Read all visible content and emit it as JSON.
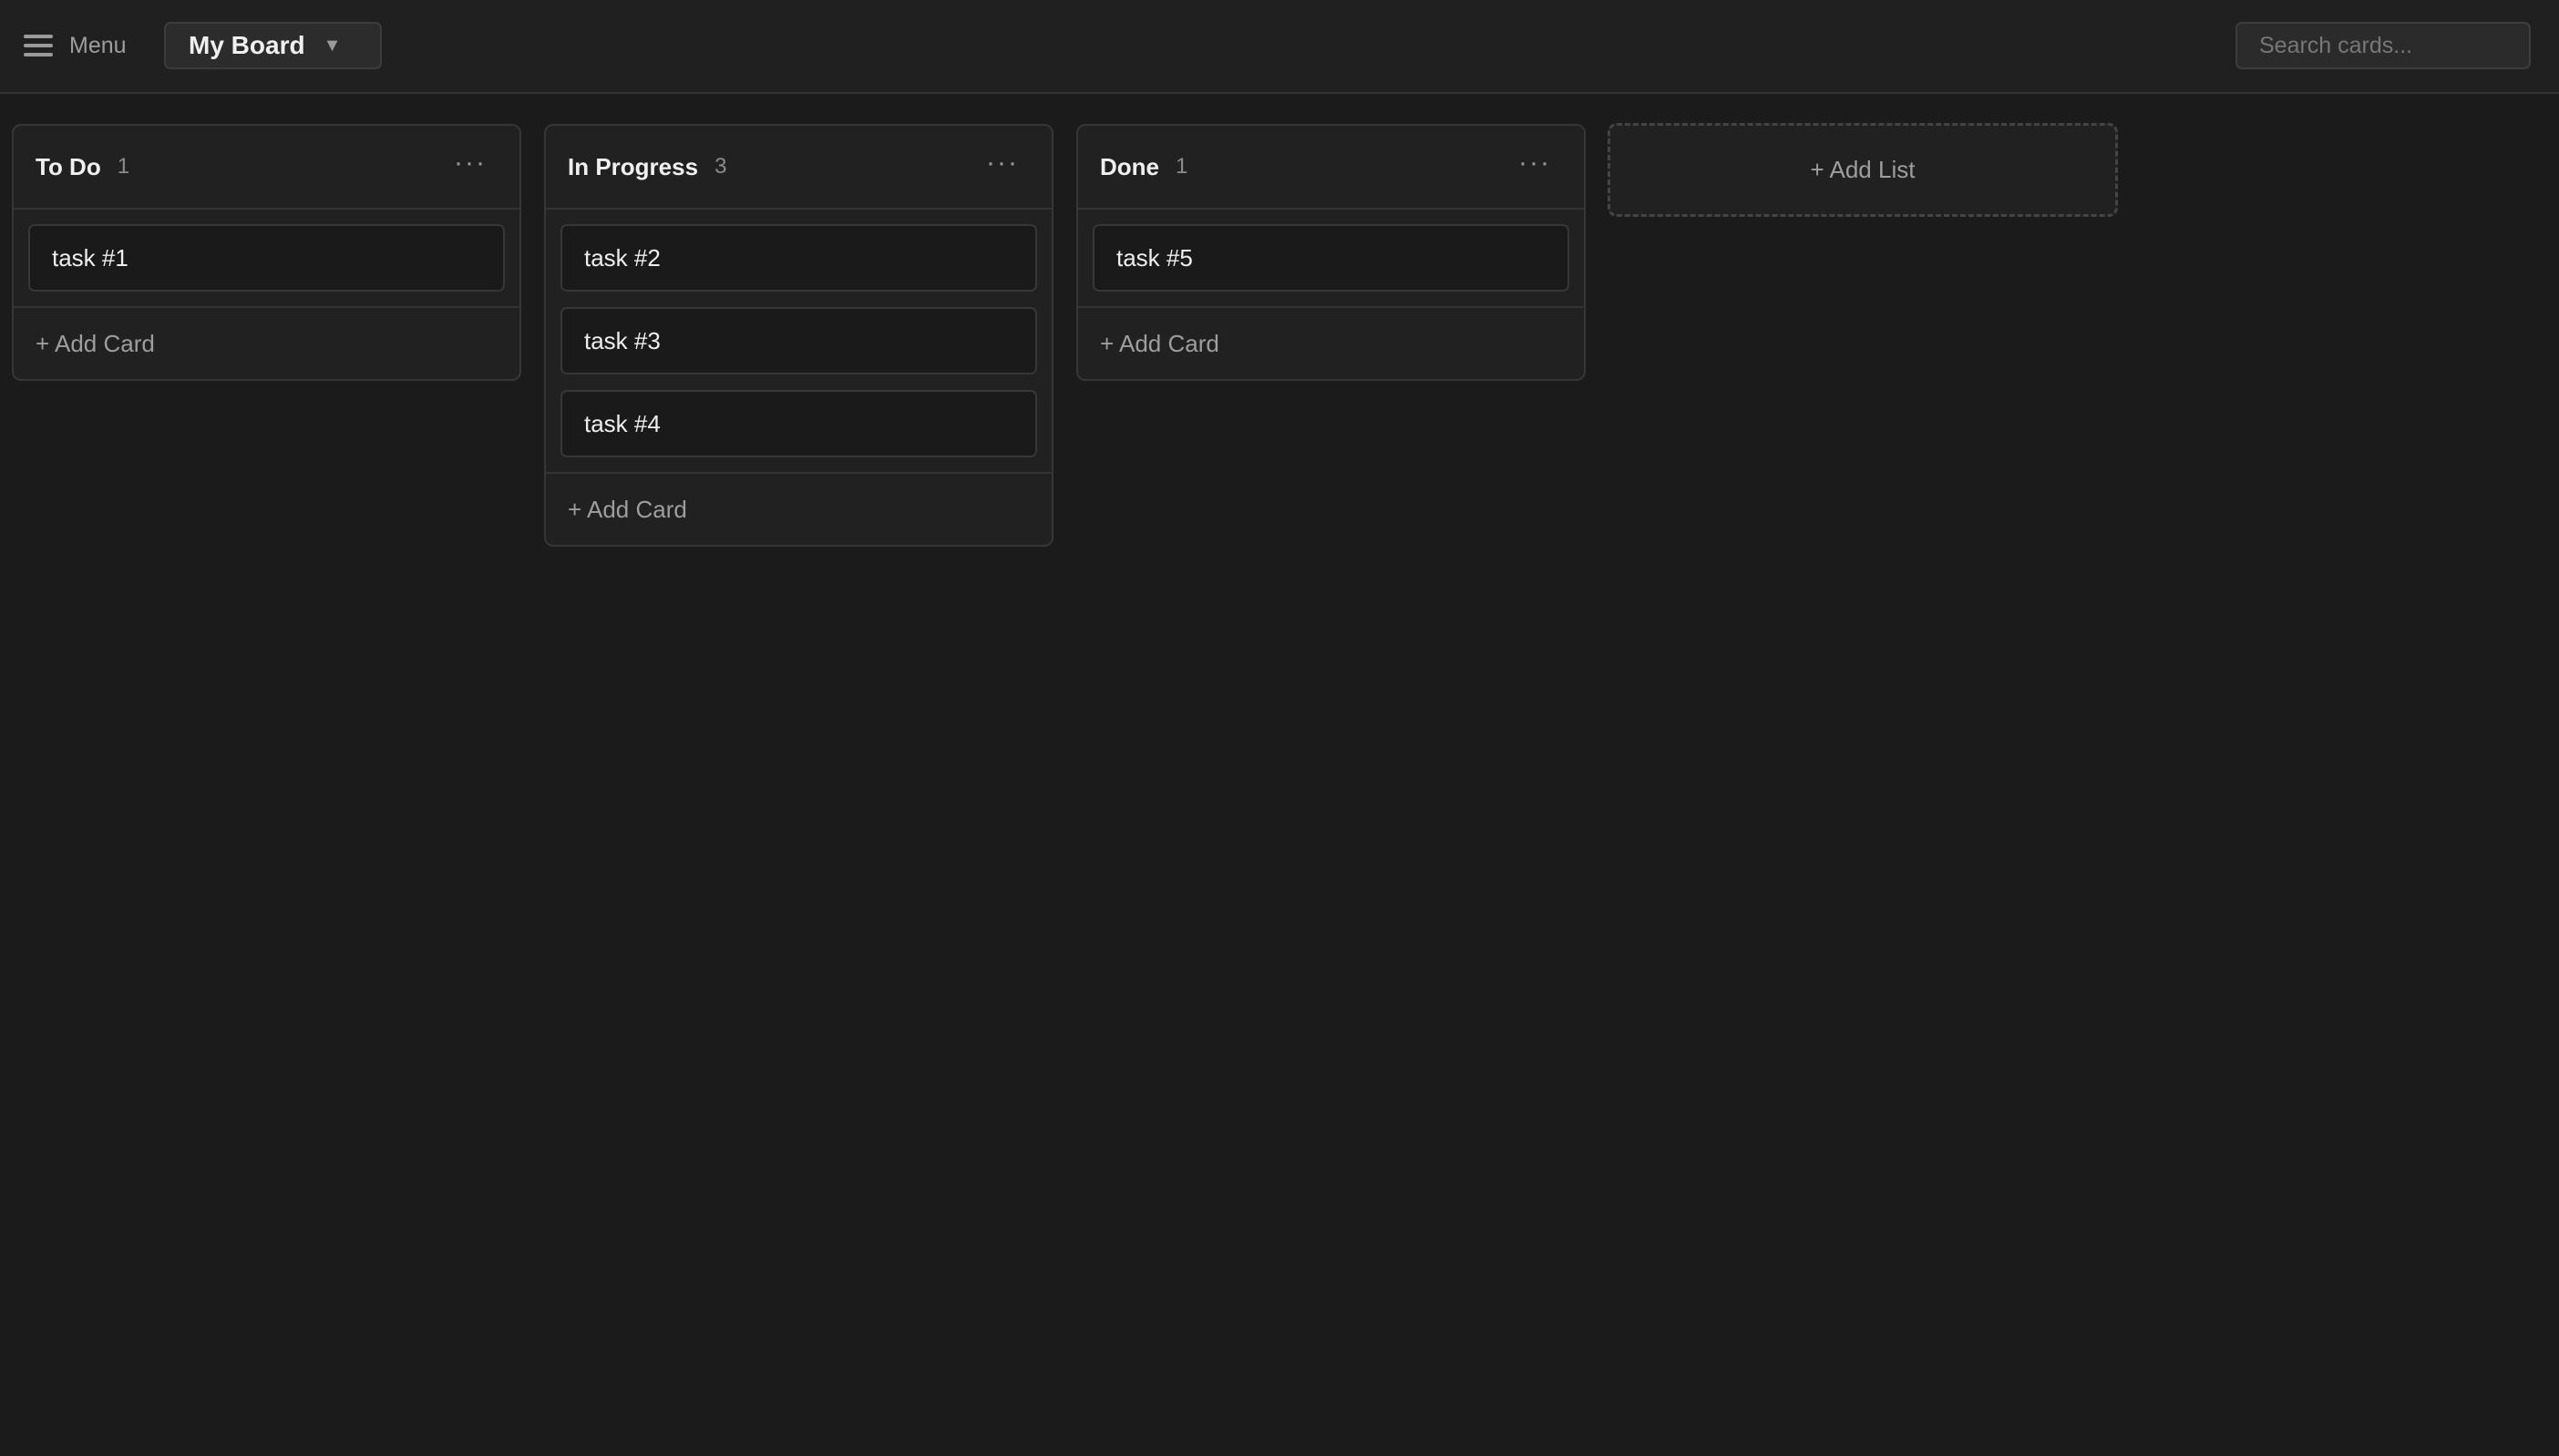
{
  "topbar": {
    "menu_label": "Menu",
    "board_title": "My Board",
    "board_caret": "▼",
    "search_placeholder": "Search cards..."
  },
  "lists": [
    {
      "title": "To Do",
      "count": "1",
      "menu": "···",
      "cards": [
        "task #1"
      ],
      "add_card": "+ Add Card"
    },
    {
      "title": "In Progress",
      "count": "3",
      "menu": "···",
      "cards": [
        "task #2",
        "task #3",
        "task #4"
      ],
      "add_card": "+ Add Card"
    },
    {
      "title": "Done",
      "count": "1",
      "menu": "···",
      "cards": [
        "task #5"
      ],
      "add_card": "+ Add Card"
    }
  ],
  "add_list": "+ Add List",
  "icons": {
    "menu": "hamburger-icon",
    "caret": "chevron-down-icon",
    "list_menu": "more-horizontal-icon"
  }
}
